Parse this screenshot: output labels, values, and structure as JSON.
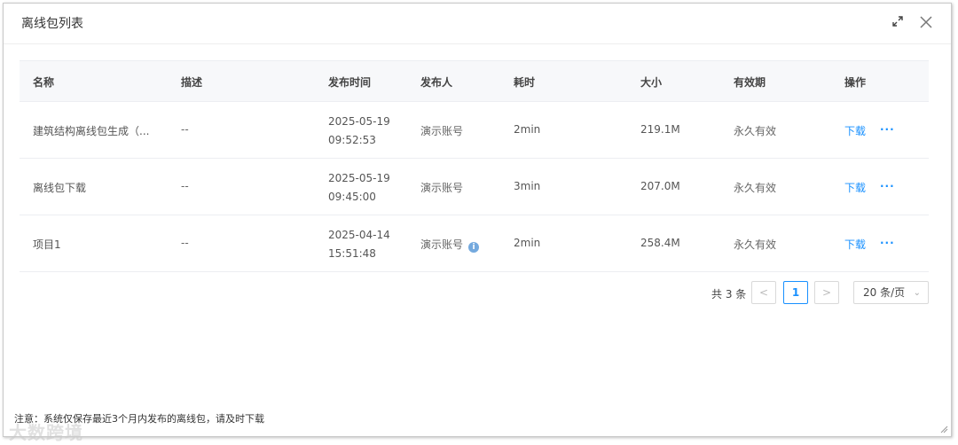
{
  "dialog": {
    "title": "离线包列表",
    "note": "注意：系统仅保存最近3个月内发布的离线包，请及时下载",
    "watermark": "大数跨境"
  },
  "table": {
    "columns": [
      "名称",
      "描述",
      "发布时间",
      "发布人",
      "耗时",
      "大小",
      "有效期",
      "操作"
    ],
    "rows": [
      {
        "name": "建筑结构离线包生成（...",
        "desc": "--",
        "date": "2025-05-19",
        "time": "09:52:53",
        "publisher": "演示账号",
        "duration": "2min",
        "size": "219.1M",
        "validity": "永久有效",
        "action": "下载",
        "more": "···"
      },
      {
        "name": "离线包下载",
        "desc": "--",
        "date": "2025-05-19",
        "time": "09:45:00",
        "publisher": "演示账号",
        "duration": "3min",
        "size": "207.0M",
        "validity": "永久有效",
        "action": "下载",
        "more": "···"
      },
      {
        "name": "项目1",
        "desc": "--",
        "date": "2025-04-14",
        "time": "15:51:48",
        "publisher": "演示账号",
        "duration": "2min",
        "size": "258.4M",
        "validity": "永久有效",
        "action": "下载",
        "more": "···"
      }
    ]
  },
  "pagination": {
    "total": "共 3 条",
    "prev": "<",
    "current": "1",
    "next": ">",
    "page_size": "20 条/页"
  },
  "icons": {
    "info": "i"
  }
}
